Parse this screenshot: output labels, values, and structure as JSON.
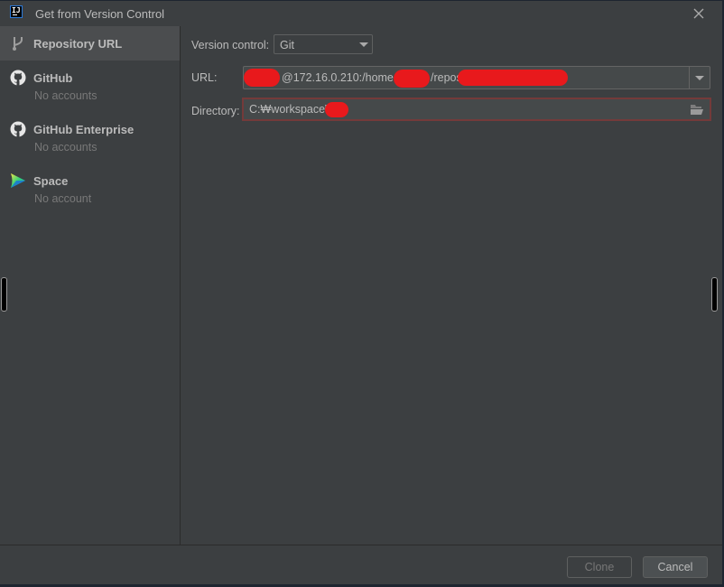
{
  "window": {
    "title": "Get from Version Control",
    "app_logo_text": "IJ"
  },
  "sidebar": {
    "items": [
      {
        "label": "Repository URL",
        "sub": "",
        "icon": "branch-icon",
        "selected": true
      },
      {
        "label": "GitHub",
        "sub": "No accounts",
        "icon": "github-icon",
        "selected": false
      },
      {
        "label": "GitHub Enterprise",
        "sub": "No accounts",
        "icon": "github-icon",
        "selected": false
      },
      {
        "label": "Space",
        "sub": "No account",
        "icon": "space-icon",
        "selected": false
      }
    ]
  },
  "form": {
    "version_control_label": "Version control:",
    "version_control_value": "Git",
    "url_label": "URL:",
    "url_value_visible": "@172.16.0.210:/home/          /repos",
    "url_parts": {
      "host": "@172.16.0.210:/home",
      "sep": "/repos"
    },
    "directory_label": "Directory:",
    "directory_value": "C:₩workspace₩"
  },
  "footer": {
    "clone_label": "Clone",
    "cancel_label": "Cancel"
  },
  "colors": {
    "background": "#3c3f41",
    "selected_item": "#4b4d4f",
    "error_border": "#743a3a",
    "redaction": "#e8191c"
  }
}
